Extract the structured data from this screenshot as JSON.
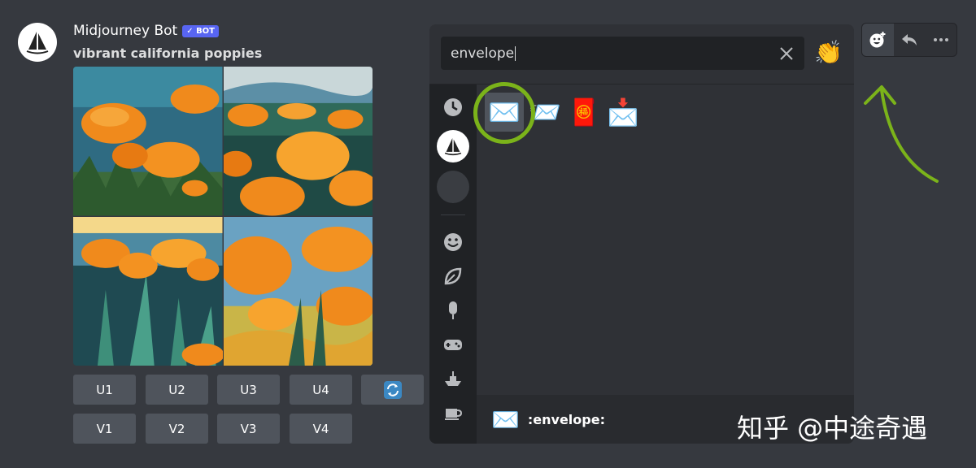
{
  "message": {
    "username": "Midjourney Bot",
    "bot_tag": "✓ BOT",
    "prompt": "vibrant california poppies"
  },
  "buttons": {
    "upscale": [
      "U1",
      "U2",
      "U3",
      "U4"
    ],
    "variation": [
      "V1",
      "V2",
      "V3",
      "V4"
    ]
  },
  "picker": {
    "search_value": "envelope",
    "skin_tone_emoji": "👏",
    "results": [
      "✉️",
      "📨",
      "🧧",
      "📩"
    ],
    "preview_emoji": "✉️",
    "preview_name": ":envelope:",
    "categories": [
      "recent-icon",
      "server-icon-midjourney",
      "server-icon-other",
      "smiley-icon",
      "leaf-icon",
      "popsicle-icon",
      "gamepad-icon",
      "boat-icon",
      "coffee-icon"
    ]
  },
  "toolbar": [
    "add-reaction-icon",
    "reply-icon",
    "more-icon"
  ],
  "watermark": "知乎 @中途奇遇",
  "colors": {
    "background": "#36393f",
    "accent": "#5865f2",
    "highlight": "#7bb31a",
    "poppy": "#f08a1c"
  }
}
